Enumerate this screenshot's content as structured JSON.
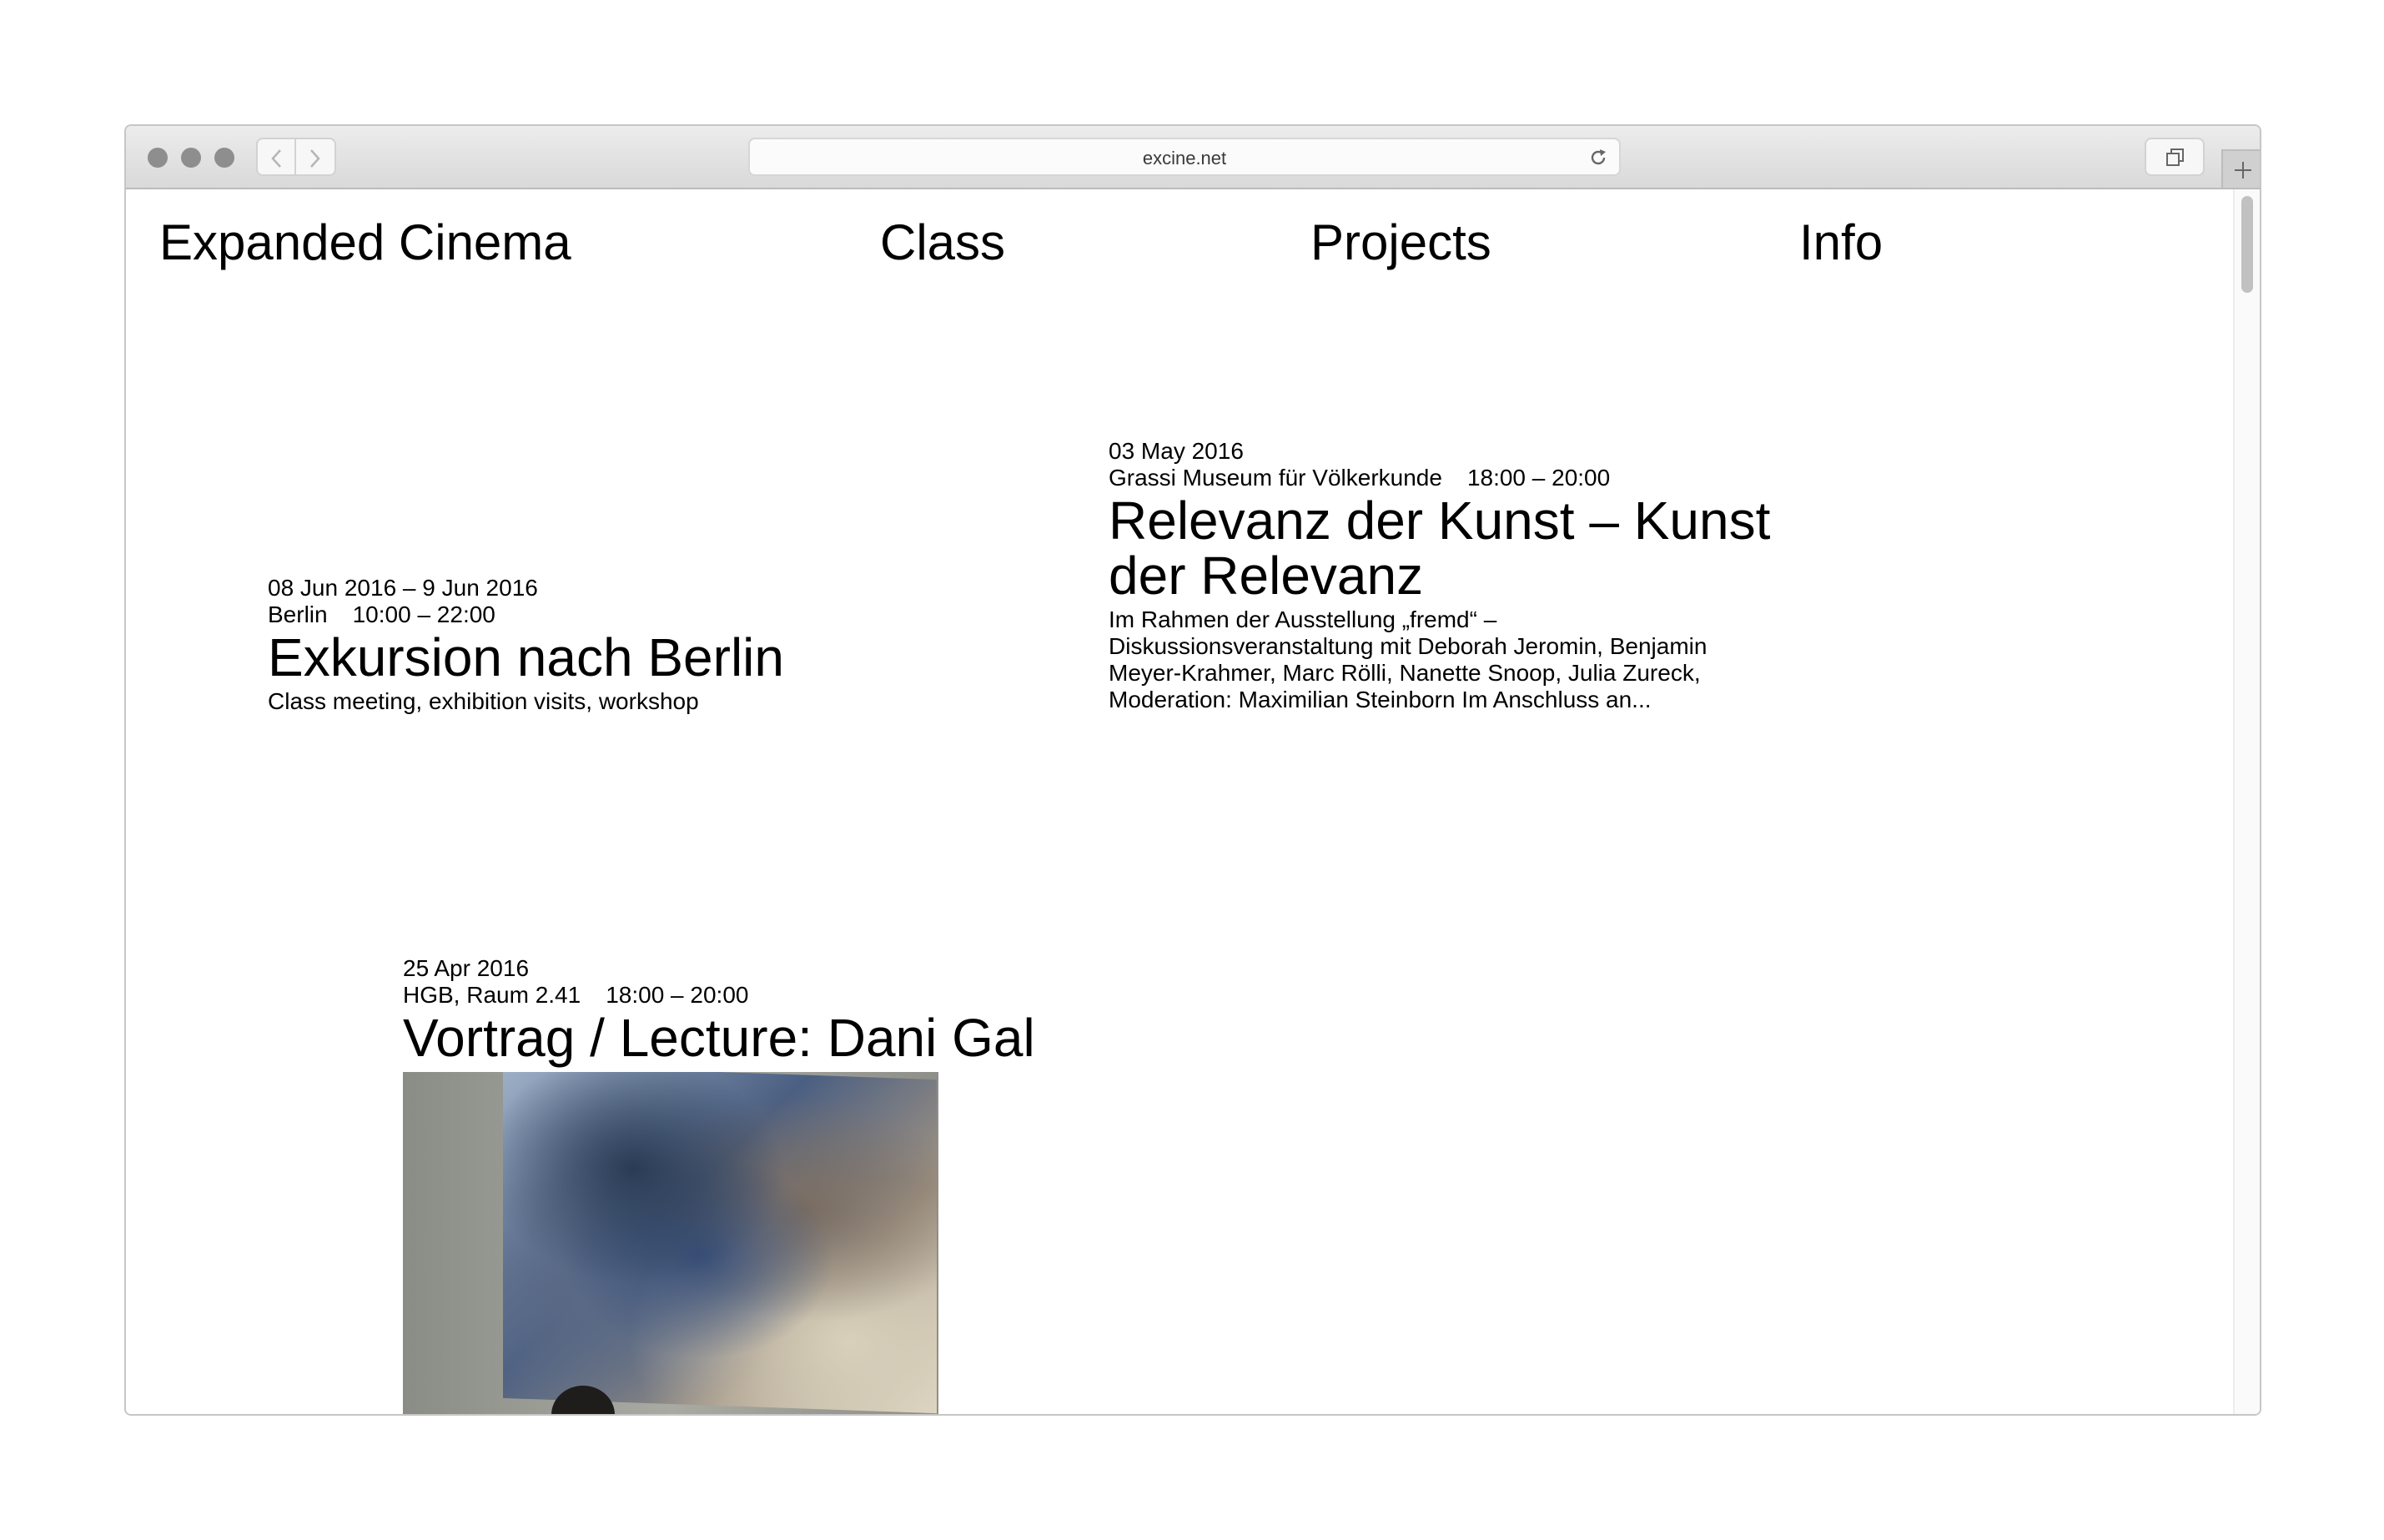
{
  "browser": {
    "url": "excine.net",
    "icons": [
      "back-arrow-icon",
      "forward-arrow-icon",
      "reload-icon",
      "tabs-overview-icon",
      "plus-icon"
    ]
  },
  "nav": {
    "brand": "Expanded Cinema",
    "items": [
      "Class",
      "Projects",
      "Info"
    ]
  },
  "events": [
    {
      "date": "03 May 2016",
      "location": "Grassi Museum für Völkerkunde",
      "time": "18:00 – 20:00",
      "title": "Relevanz der Kunst – Kunst der Relevanz",
      "desc_lines": [
        "Im Rahmen der Ausstellung „fremd“ –",
        "Diskussionsveranstaltung mit Deborah Jeromin, Benjamin",
        "Meyer-Krahmer, Marc Rölli, Nanette Snoop, Julia Zureck,",
        "Moderation: Maximilian Steinborn Im Anschluss an..."
      ]
    },
    {
      "date": "08 Jun 2016 – 9 Jun 2016",
      "location": "Berlin",
      "time": "10:00 – 22:00",
      "title": "Exkursion nach Berlin",
      "desc": "Class meeting, exhibition visits, workshop"
    },
    {
      "date": "25 Apr 2016",
      "location": "HGB, Raum 2.41",
      "time": "18:00 – 20:00",
      "title": "Vortrag / Lecture: Dani Gal"
    }
  ]
}
